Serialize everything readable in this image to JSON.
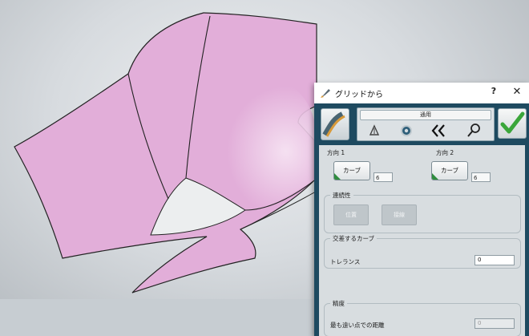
{
  "dialog": {
    "title": "グリッドから",
    "help_label": "?",
    "close_label": "✕",
    "mode_label": "通用",
    "direction1": {
      "label": "方向 1",
      "button_label": "カーブ",
      "count": "6"
    },
    "direction2": {
      "label": "方向 2",
      "button_label": "カーブ",
      "count": "6"
    },
    "continuity": {
      "title": "連続性",
      "btn1": "位置",
      "btn2": "接線"
    },
    "intersect_curves": {
      "title": "交差するカーブ"
    },
    "tolerance": {
      "label": "トレランス",
      "value": "0"
    },
    "accuracy": {
      "title": "精度",
      "farthest_label": "最も遠い点での距離",
      "farthest_value": "0"
    }
  },
  "colors": {
    "surface": "#e2aed9",
    "surface_highlight": "#f5e0f2",
    "dialog_body": "#1e4a60",
    "panel": "#d8dde0",
    "accent_green": "#2f8c3e"
  },
  "icons": [
    "brush-icon",
    "surface-tool-icon",
    "draft-triangle-icon",
    "gear-icon",
    "double-chevron-left-icon",
    "magnifier-icon",
    "checkmark-icon"
  ]
}
